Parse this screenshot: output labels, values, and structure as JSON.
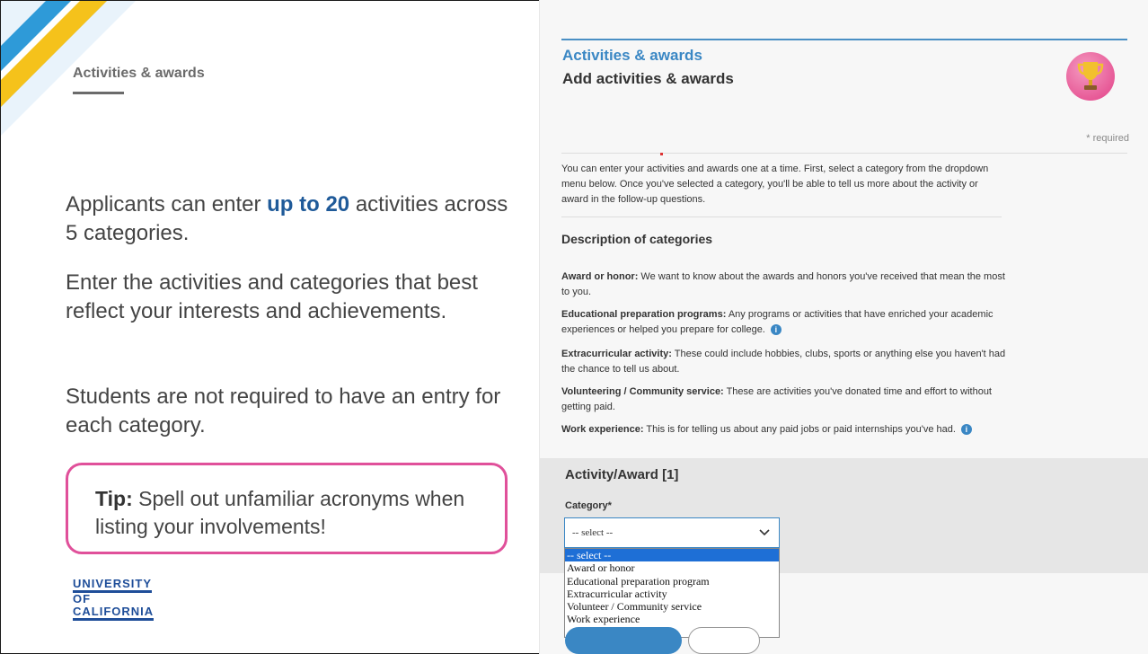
{
  "slide": {
    "title": "Activities & awards",
    "para1_pre": "Applicants can enter ",
    "para1_highlight": "up to 20",
    "para1_post": " activities across 5 categories.",
    "para2": "Enter the activities and categories that best reflect your interests and achievements.",
    "para3": "Students are not required to have an entry for each category.",
    "tip_label": "Tip:",
    "tip_text": " Spell out unfamiliar acronyms when listing your involvements!",
    "logo_lines": [
      "UNIVERSITY",
      "OF",
      "CALIFORNIA"
    ]
  },
  "app": {
    "section_title": "Activities & awards",
    "page_title": "Add activities & awards",
    "required_note": "* required",
    "intro": "You can enter your activities and awards one at a time. First, select a category from the dropdown menu below. Once you've selected a category, you'll be able to tell us more about the activity or award in the follow-up questions.",
    "desc_heading": "Description of categories",
    "categories": [
      {
        "name": "Award or honor:",
        "text": " We want to know about the awards and honors you've received that mean the most to you."
      },
      {
        "name": "Educational preparation programs:",
        "text": " Any programs or activities that have enriched your academic experiences or helped you prepare for college."
      },
      {
        "name": "Extracurricular activity:",
        "text": " These could include hobbies, clubs, sports or anything else you haven't had the chance to tell us about."
      },
      {
        "name": "Volunteering / Community service:",
        "text": " These are activities you've donated time and effort to without getting paid."
      },
      {
        "name": "Work experience:",
        "text": " This is for telling us about any paid jobs or paid internships you've had."
      }
    ],
    "info_glyph": "i",
    "entry_title": "Activity/Award [1]",
    "category_label": "Category*",
    "select_value": "-- select --",
    "options": [
      "-- select --",
      "Award or honor",
      "Educational preparation program",
      "Extracurricular activity",
      "Volunteer / Community service",
      "Work experience"
    ]
  },
  "colors": {
    "accent_blue": "#3a87c4",
    "tip_border": "#e0509a",
    "highlight": "#1f5a99"
  }
}
